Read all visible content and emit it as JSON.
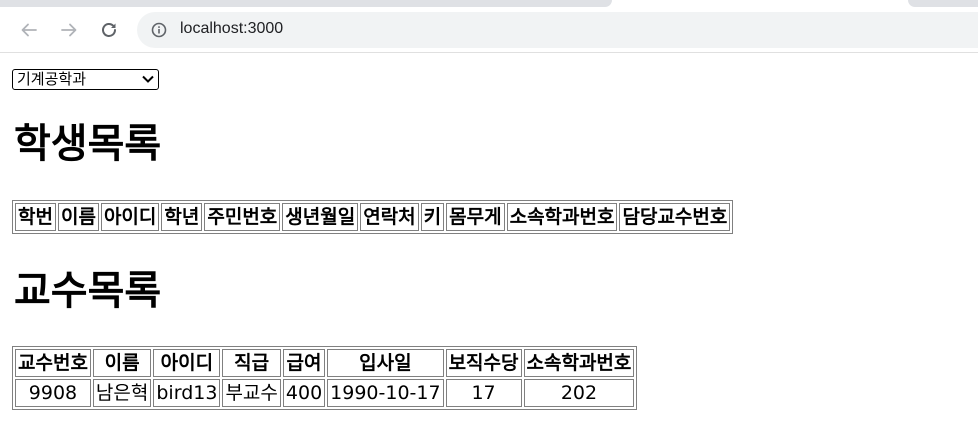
{
  "browser": {
    "url": "localhost:3000"
  },
  "filter": {
    "selected_department": "기계공학과"
  },
  "students": {
    "heading": "학생목록",
    "columns": [
      "학번",
      "이름",
      "아이디",
      "학년",
      "주민번호",
      "생년월일",
      "연락처",
      "키",
      "몸무게",
      "소속학과번호",
      "담당교수번호"
    ],
    "rows": []
  },
  "professors": {
    "heading": "교수목록",
    "columns": [
      "교수번호",
      "이름",
      "아이디",
      "직급",
      "급여",
      "입사일",
      "보직수당",
      "소속학과번호"
    ],
    "rows": [
      [
        "9908",
        "남은혁",
        "bird13",
        "부교수",
        "400",
        "1990-10-17",
        "17",
        "202"
      ]
    ]
  }
}
